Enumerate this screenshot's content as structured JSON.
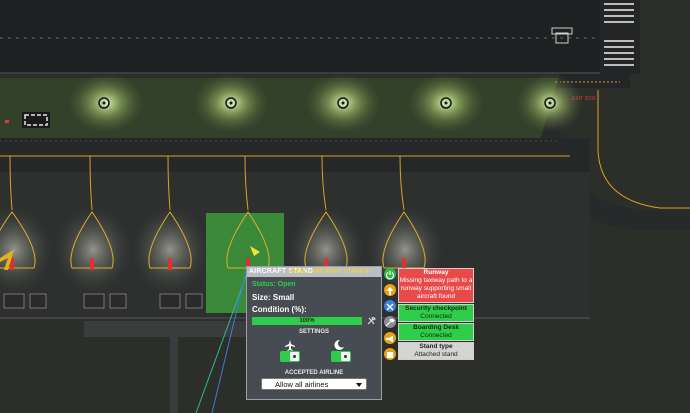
{
  "panel": {
    "title": "AIRCRAFT STAND",
    "subtitle": "SMALL AIRCRAFT STAND 6",
    "status": "Status: Open",
    "size": "Size: Small",
    "condition_label": "Condition (%):",
    "condition_value": "100%",
    "condition_fraction": 1.0,
    "settings_label": "SETTINGS",
    "setting_day_icon": "aircraft-arrival-icon",
    "setting_night_icon": "moon-icon",
    "setting_day_enabled": true,
    "setting_night_enabled": true,
    "accepted_label": "ACCEPTED AIRLINE",
    "airline_selected": "Allow all airlines"
  },
  "sidebar": {
    "icons": [
      "power-icon",
      "arrow-up-icon",
      "wrench-screwdriver-icon",
      "tools-icon",
      "megaphone-icon",
      "building-icon"
    ],
    "colors": [
      "#2fb84a",
      "#e8a11a",
      "#3a7fd8",
      "#8a8f96",
      "#e8a11a",
      "#e8a11a"
    ]
  },
  "info_cards": [
    {
      "title": "Runway",
      "text": "Missing taxiway path to a runway supporting small aircraft found",
      "bg": "#e84a4a",
      "color": "#ffffff"
    },
    {
      "title": "Security checkpoint",
      "text": "Connected",
      "bg": "#2fce4a",
      "color": "#102a10"
    },
    {
      "title": "Boarding Desk",
      "text": "Connected",
      "bg": "#2fce4a",
      "color": "#102a10"
    },
    {
      "title": "Stand type",
      "text": "Attached stand",
      "bg": "#d4d4d4",
      "color": "#222222"
    }
  ],
  "map": {
    "runway_exit_label": "EXIT 3502"
  }
}
